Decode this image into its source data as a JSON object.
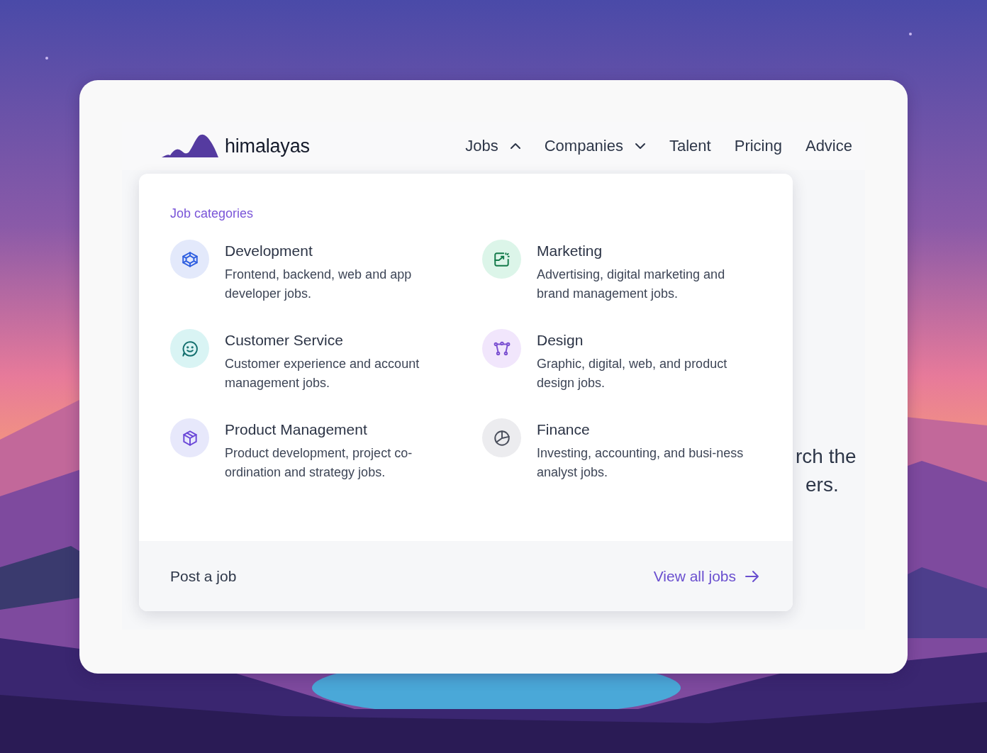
{
  "brand": {
    "name": "himalayas"
  },
  "nav": [
    {
      "label": "Jobs",
      "kind": "dropdown",
      "expanded": true
    },
    {
      "label": "Companies",
      "kind": "dropdown",
      "expanded": false
    },
    {
      "label": "Talent",
      "kind": "link"
    },
    {
      "label": "Pricing",
      "kind": "link"
    },
    {
      "label": "Advice",
      "kind": "link"
    }
  ],
  "background_text": [
    "rch the",
    "ers."
  ],
  "menu": {
    "heading": "Job categories",
    "categories": [
      {
        "title": "Development",
        "description": "Frontend, backend, web and app developer jobs."
      },
      {
        "title": "Marketing",
        "description": "Advertising, digital marketing and brand management jobs."
      },
      {
        "title": "Customer Service",
        "description": "Customer experience and account management jobs."
      },
      {
        "title": "Design",
        "description": "Graphic, digital, web, and product design jobs."
      },
      {
        "title": "Product Management",
        "description": "Product development, project co-ordination and strategy jobs."
      },
      {
        "title": "Finance",
        "description": "Investing, accounting, and busi-ness analyst jobs."
      }
    ],
    "footer_link": "Post a job",
    "view_all": "View all jobs"
  }
}
